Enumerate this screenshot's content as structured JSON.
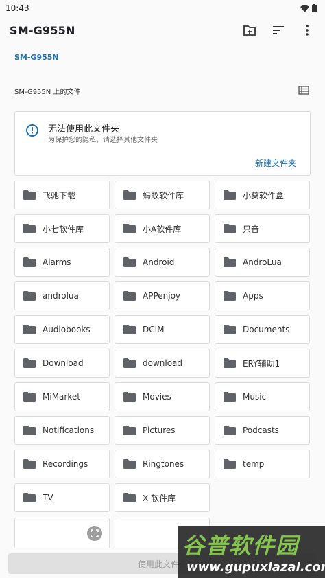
{
  "status_bar": {
    "time": "10:43"
  },
  "toolbar": {
    "title": "SM-G955N"
  },
  "breadcrumb": {
    "root": "SM-G955N"
  },
  "section": {
    "title": "SM-G955N 上的文件"
  },
  "warning": {
    "title": "无法使用此文件夹",
    "subtitle": "为保护您的隐私，请选择其他文件夹",
    "action": "新建文件夹"
  },
  "folders": [
    "飞驰下载",
    "蚂蚁软件库",
    "小葵软件盒",
    "小七软件库",
    "小A软件库",
    "只音",
    "Alarms",
    "Android",
    "AndroLua",
    "androlua",
    "APPenjoy",
    "Apps",
    "Audiobooks",
    "DCIM",
    "Documents",
    "Download",
    "download",
    "ERY辅助1",
    "MiMarket",
    "Movies",
    "Music",
    "Notifications",
    "Pictures",
    "Podcasts",
    "Recordings",
    "Ringtones",
    "temp",
    "TV",
    "X 软件库"
  ],
  "bottom": {
    "use_button": "使用此文件夹"
  },
  "watermark": {
    "logo": "谷普软件园",
    "url": "www.gupuxlazal.com"
  },
  "colors": {
    "accent": "#1a73b8",
    "folder_icon": "#5f6368"
  }
}
